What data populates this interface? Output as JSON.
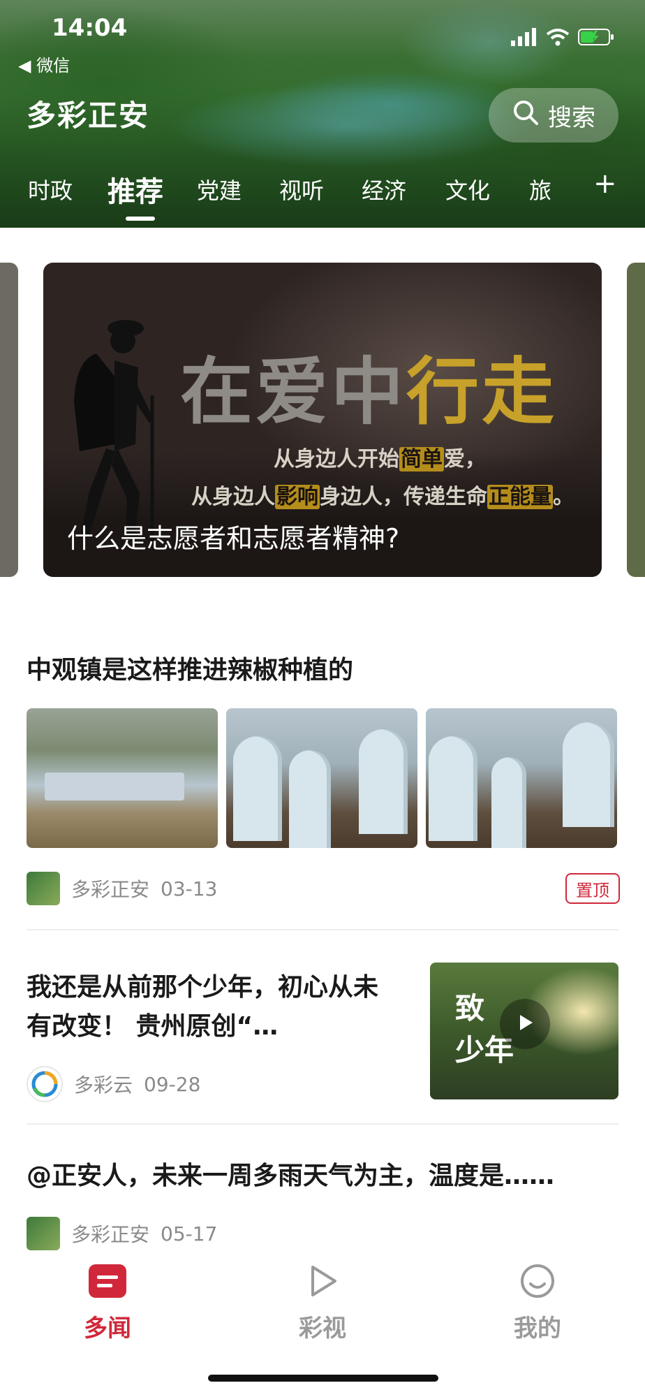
{
  "status_bar": {
    "time": "14:04",
    "back_label": "◀ 微信"
  },
  "header": {
    "app_title": "多彩正安",
    "search_label": "搜索",
    "tabs": [
      "时政",
      "推荐",
      "党建",
      "视听",
      "经济",
      "文化",
      "旅"
    ],
    "active_tab": "推荐",
    "add_tab_glyph": "+"
  },
  "banner": {
    "headline_part1": "在爱中",
    "headline_part2": "行走",
    "line1_a": "从身边人开始",
    "line1_hl": "简单",
    "line1_b": "爱，",
    "line2_a": "从身边人",
    "line2_hl1": "影响",
    "line2_b": "身边人，传递生命",
    "line2_hl2": "正能量",
    "line2_c": "。",
    "caption": "什么是志愿者和志愿者精神?"
  },
  "feed": [
    {
      "title": "中观镇是这样推进辣椒种植的",
      "source": "多彩正安",
      "date": "03-13",
      "badge": "置顶"
    },
    {
      "title": "我还是从前那个少年，初心从未有改变！ 贵州原创“…",
      "source": "多彩云",
      "date": "09-28",
      "video_text": "致\n少年"
    },
    {
      "title": "@正安人，未来一周多雨天气为主，温度是……",
      "source": "多彩正安",
      "date": "05-17"
    }
  ],
  "bottom_nav": {
    "items": [
      "多闻",
      "彩视",
      "我的"
    ],
    "active": "多闻"
  },
  "colors": {
    "accent_red": "#d0283a",
    "muted_gray": "#9a9a9a",
    "banner_gold": "#c7a12a"
  }
}
